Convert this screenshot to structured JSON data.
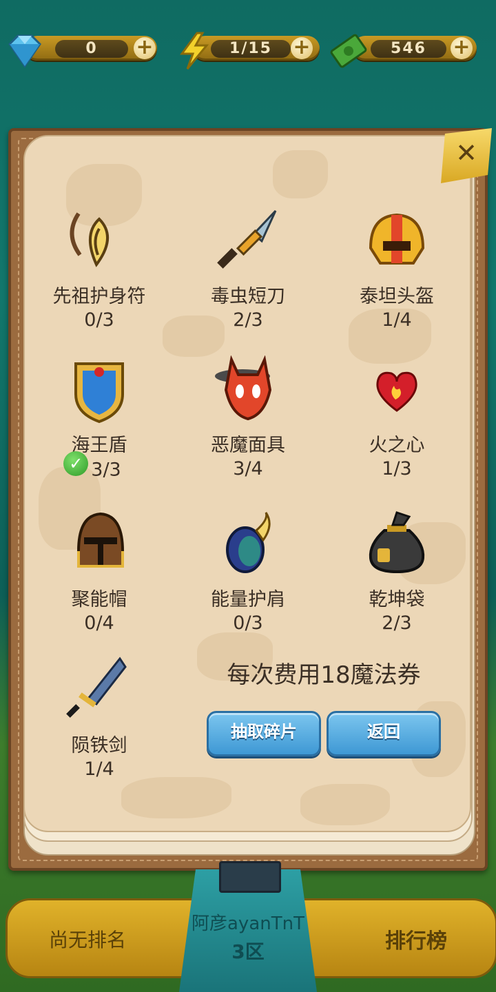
{
  "resources": {
    "gems": {
      "icon": "diamond-icon",
      "value": "0"
    },
    "energy": {
      "icon": "lightning-icon",
      "value": "1/15"
    },
    "cash": {
      "icon": "cash-icon",
      "value": "546"
    }
  },
  "items": [
    {
      "name": "先祖护身符",
      "count": "0/3",
      "icon": "amulet-icon",
      "complete": false
    },
    {
      "name": "毒虫短刀",
      "count": "2/3",
      "icon": "dagger-icon",
      "complete": false
    },
    {
      "name": "泰坦头盔",
      "count": "1/4",
      "icon": "titan-helmet-icon",
      "complete": false
    },
    {
      "name": "海王盾",
      "count": "3/3",
      "icon": "shield-icon",
      "complete": true
    },
    {
      "name": "恶魔面具",
      "count": "3/4",
      "icon": "demon-mask-icon",
      "complete": false
    },
    {
      "name": "火之心",
      "count": "1/3",
      "icon": "fire-heart-icon",
      "complete": false
    },
    {
      "name": "聚能帽",
      "count": "0/4",
      "icon": "knight-helmet-icon",
      "complete": false
    },
    {
      "name": "能量护肩",
      "count": "0/3",
      "icon": "shoulder-pad-icon",
      "complete": false
    },
    {
      "name": "乾坤袋",
      "count": "2/3",
      "icon": "money-bag-icon",
      "complete": false
    },
    {
      "name": "陨铁剑",
      "count": "1/4",
      "icon": "meteor-sword-icon",
      "complete": false
    }
  ],
  "draw_panel": {
    "cost_text": "每次费用18魔法券",
    "draw_button": "抽取碎片",
    "back_button": "返回"
  },
  "bottom_bar": {
    "rank_text": "尚无排名",
    "player_name": "阿彦ayanTnT",
    "server": "3区",
    "leaderboard_button": "排行榜"
  },
  "colors": {
    "panel_parchment": "#ecd7b7",
    "button_blue": "#3e98d4",
    "bar_gold": "#e0b22a"
  }
}
